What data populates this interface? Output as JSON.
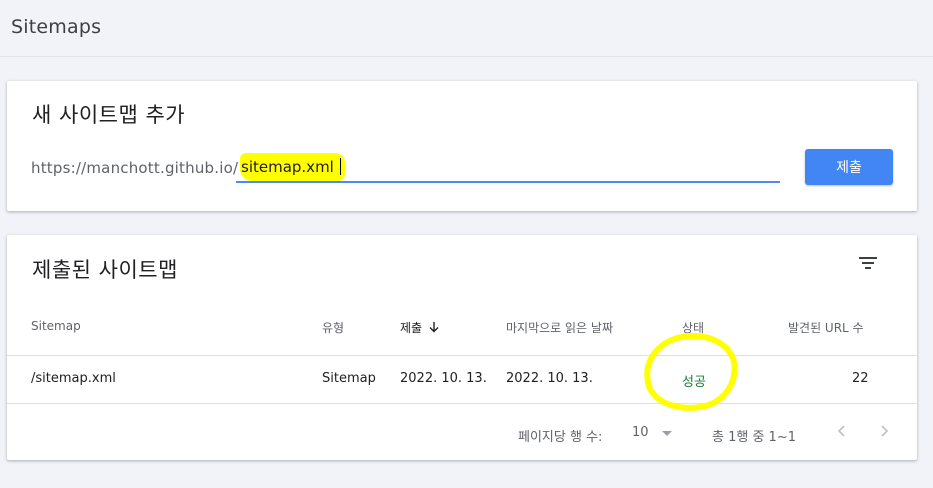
{
  "header": {
    "title": "Sitemaps"
  },
  "add_sitemap": {
    "title": "새 사이트맵 추가",
    "url_prefix": "https://manchott.github.io/",
    "input_value": "sitemap.xml",
    "submit_label": "제출"
  },
  "submitted": {
    "title": "제출된 사이트맵",
    "columns": {
      "sitemap": "Sitemap",
      "type": "유형",
      "submitted": "제출",
      "last_read": "마지막으로 읽은 날짜",
      "status": "상태",
      "urls_found": "발견된 URL 수"
    },
    "rows": [
      {
        "sitemap": "/sitemap.xml",
        "type": "Sitemap",
        "submitted": "2022. 10. 13.",
        "last_read": "2022. 10. 13.",
        "status": "성공",
        "urls_found": "22"
      }
    ],
    "footer": {
      "rows_per_page_label": "페이지당 행 수:",
      "rows_per_page_value": "10",
      "range_text": "총 1행 중 1~1"
    }
  },
  "icons": {
    "filter": "filter-icon",
    "sort": "arrow-down-icon",
    "prev": "chevron-left-icon",
    "next": "chevron-right-icon"
  },
  "colors": {
    "accent": "#4285f4",
    "success": "#188038",
    "highlight": "#ffff00"
  }
}
